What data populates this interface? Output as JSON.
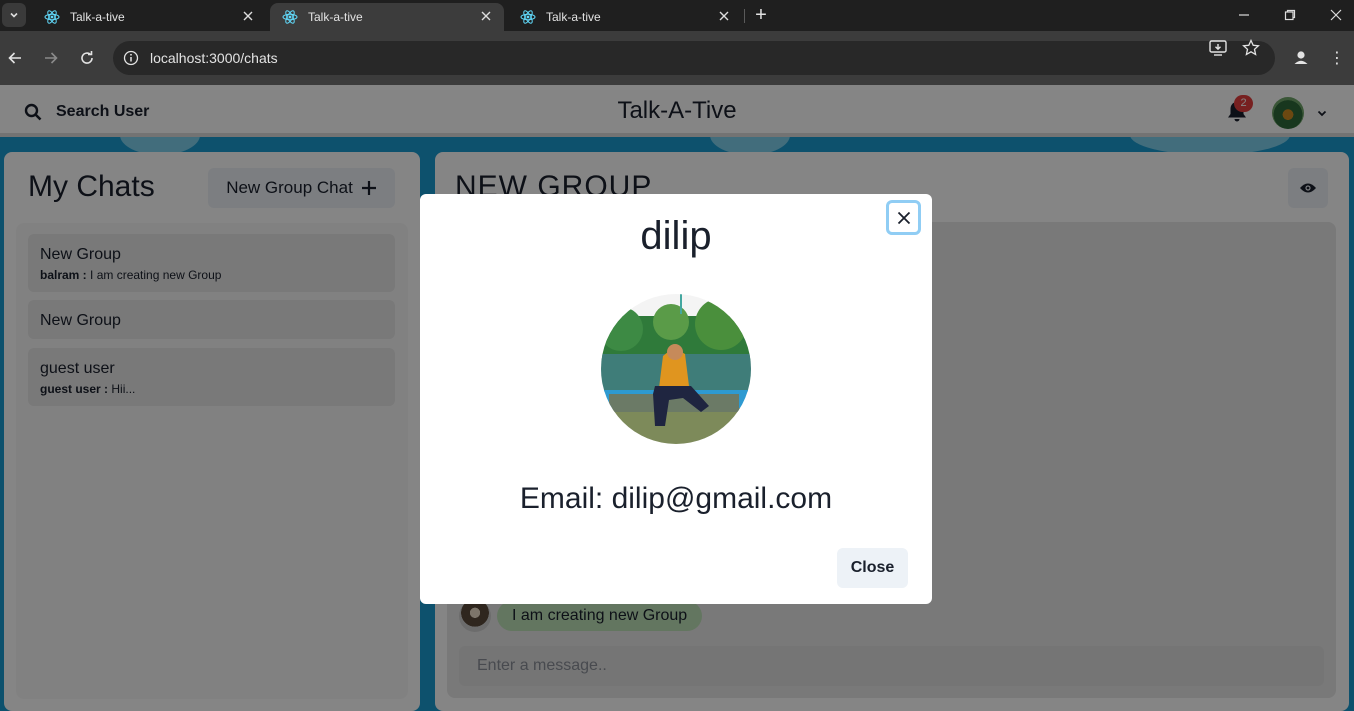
{
  "browser": {
    "tabs": [
      {
        "title": "Talk-a-tive",
        "active": false
      },
      {
        "title": "Talk-a-tive",
        "active": true
      },
      {
        "title": "Talk-a-tive",
        "active": false
      }
    ],
    "url": "localhost:3000/chats"
  },
  "header": {
    "search_label": "Search User",
    "app_title": "Talk-A-Tive",
    "notification_count": "2"
  },
  "my_chats": {
    "title": "My Chats",
    "new_group_label": "New Group Chat",
    "items": [
      {
        "name": "New Group",
        "sender": "balram :",
        "message": "I am creating new Group"
      },
      {
        "name": "New Group",
        "sender": "",
        "message": ""
      },
      {
        "name": "guest user",
        "sender": "guest user :",
        "message": "Hii..."
      }
    ]
  },
  "chat": {
    "heading": "NEW GROUP",
    "messages": [
      {
        "text": "I am creating new Group"
      }
    ],
    "input_placeholder": "Enter a message.."
  },
  "profile_modal": {
    "name": "dilip",
    "email": "Email: dilip@gmail.com",
    "close_label": "Close"
  },
  "colors": {
    "background": "#1a9bd1",
    "badge": "#e53e3e",
    "message_bubble": "#bee3b8",
    "focus_ring": "#90cdf4"
  },
  "icons": {
    "tab": "react-icon",
    "search": "search-icon",
    "bell": "bell-icon",
    "eye": "eye-icon",
    "plus": "plus-icon",
    "close": "close-icon"
  }
}
